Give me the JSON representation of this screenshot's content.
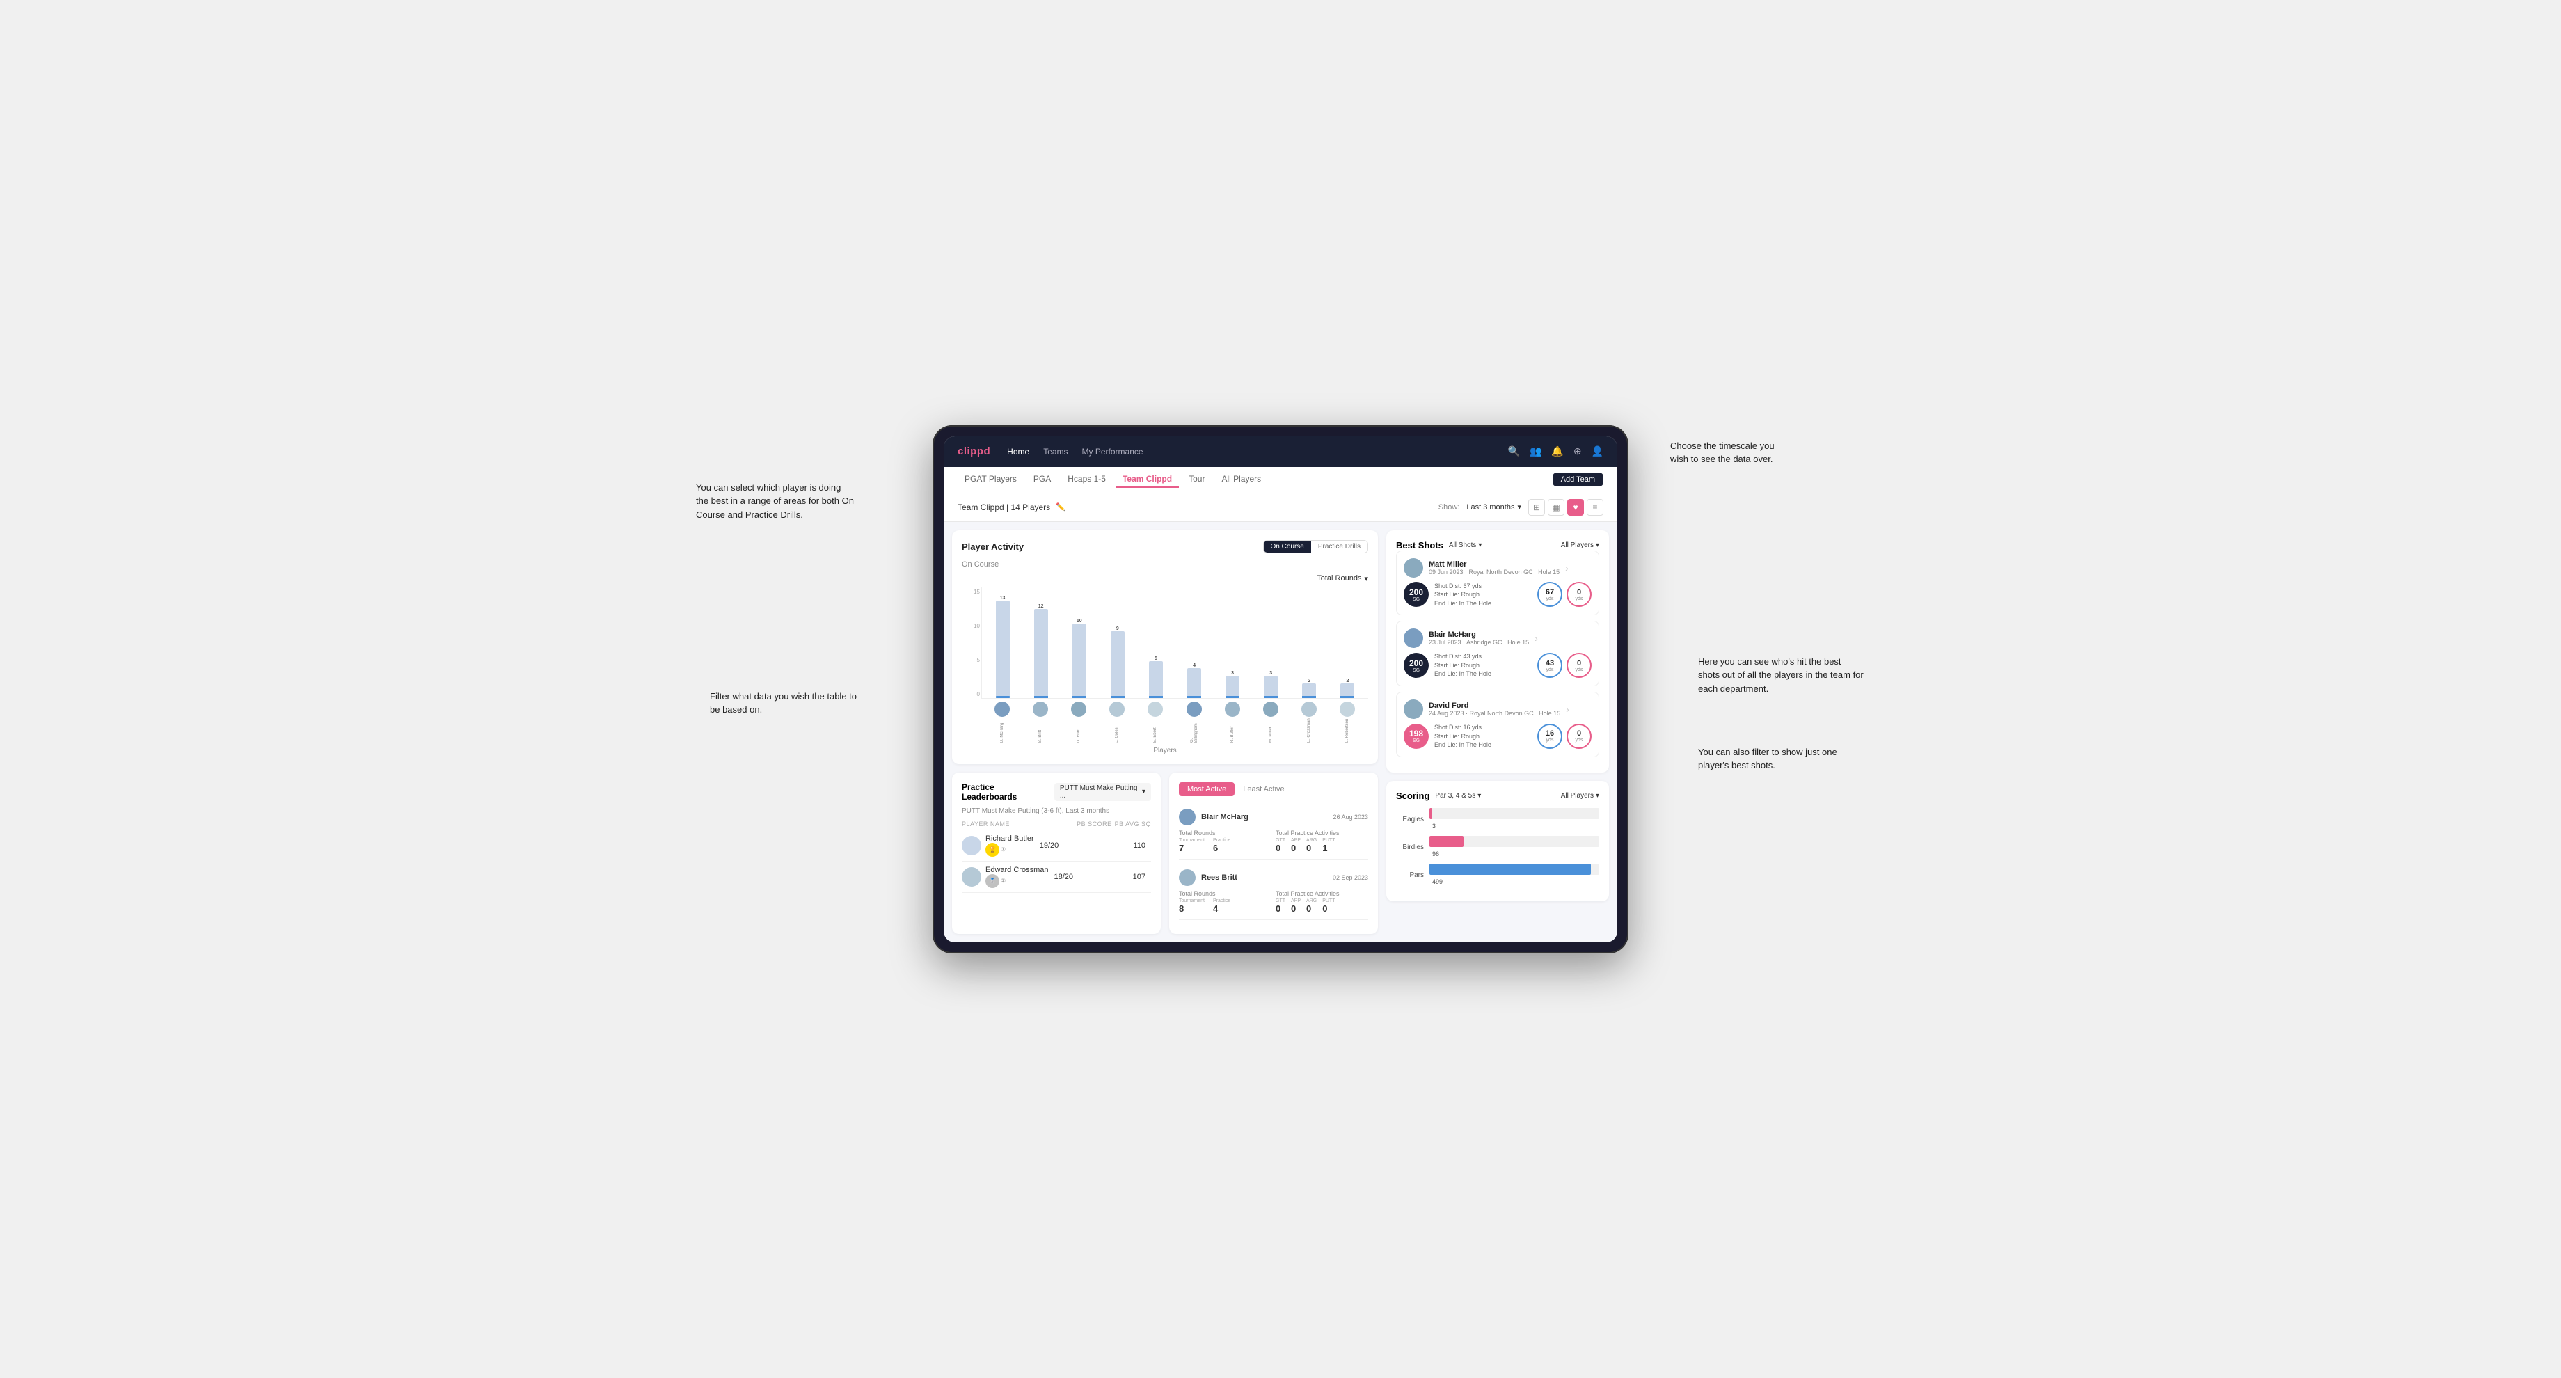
{
  "annotations": {
    "top_right": "Choose the timescale you\nwish to see the data over.",
    "left_top": "You can select which player is doing the best in a range of areas for both On Course and Practice Drills.",
    "left_bottom": "Filter what data you wish the table to be based on.",
    "right_mid": "Here you can see who's hit the best shots out of all the players in the team for each department.",
    "right_bottom": "You can also filter to show just one player's best shots."
  },
  "nav": {
    "logo": "clippd",
    "links": [
      "Home",
      "Teams",
      "My Performance"
    ],
    "icons": [
      "search",
      "users",
      "bell",
      "plus",
      "avatar"
    ]
  },
  "sub_nav": {
    "tabs": [
      "PGAT Players",
      "PGA",
      "Hcaps 1-5",
      "Team Clippd",
      "Tour",
      "All Players"
    ],
    "active_tab": "Team Clippd",
    "add_team_label": "Add Team"
  },
  "team_header": {
    "title": "Team Clippd | 14 Players",
    "show_label": "Show:",
    "date_filter": "Last 3 months",
    "view_modes": [
      "grid-2",
      "grid",
      "heart",
      "list"
    ]
  },
  "player_activity": {
    "title": "Player Activity",
    "toggle_left": "On Course",
    "toggle_right": "Practice Drills",
    "section_label": "On Course",
    "chart_filter": "Total Rounds",
    "players_label": "Players",
    "bars": [
      {
        "name": "B. McHarg",
        "value": 13
      },
      {
        "name": "B. Britt",
        "value": 12
      },
      {
        "name": "D. Ford",
        "value": 10
      },
      {
        "name": "J. Coles",
        "value": 9
      },
      {
        "name": "E. Ebert",
        "value": 5
      },
      {
        "name": "G. Billingham",
        "value": 4
      },
      {
        "name": "R. Butler",
        "value": 3
      },
      {
        "name": "M. Miller",
        "value": 3
      },
      {
        "name": "E. Crossman",
        "value": 2
      },
      {
        "name": "L. Robertson",
        "value": 2
      }
    ],
    "y_labels": [
      "15",
      "10",
      "5",
      "0"
    ]
  },
  "best_shots": {
    "title": "Best Shots",
    "filter1": "All Shots",
    "filter2": "All Players",
    "players": [
      {
        "name": "Matt Miller",
        "date": "09 Jun 2023",
        "course": "Royal North Devon GC",
        "hole": "Hole 15",
        "badge_num": "200",
        "badge_label": "SG",
        "shot_dist": "Shot Dist: 67 yds",
        "start_lie": "Start Lie: Rough",
        "end_lie": "End Lie: In The Hole",
        "metric1": "67",
        "metric1_unit": "yds",
        "metric2": "0",
        "metric2_unit": "yds"
      },
      {
        "name": "Blair McHarg",
        "date": "23 Jul 2023",
        "course": "Ashridge GC",
        "hole": "Hole 15",
        "badge_num": "200",
        "badge_label": "SG",
        "shot_dist": "Shot Dist: 43 yds",
        "start_lie": "Start Lie: Rough",
        "end_lie": "End Lie: In The Hole",
        "metric1": "43",
        "metric1_unit": "yds",
        "metric2": "0",
        "metric2_unit": "yds"
      },
      {
        "name": "David Ford",
        "date": "24 Aug 2023",
        "course": "Royal North Devon GC",
        "hole": "Hole 15",
        "badge_num": "198",
        "badge_label": "SG",
        "shot_dist": "Shot Dist: 16 yds",
        "start_lie": "Start Lie: Rough",
        "end_lie": "End Lie: In The Hole",
        "metric1": "16",
        "metric1_unit": "yds",
        "metric2": "0",
        "metric2_unit": "yds"
      }
    ]
  },
  "practice_leaderboards": {
    "title": "Practice Leaderboards",
    "filter": "PUTT Must Make Putting ...",
    "subtitle": "PUTT Must Make Putting (3-6 ft), Last 3 months",
    "cols": [
      "PLAYER NAME",
      "PB SCORE",
      "PB AVG SQ"
    ],
    "players": [
      {
        "rank": 1,
        "name": "Richard Butler",
        "pb_score": "19/20",
        "pb_avg": "110"
      },
      {
        "rank": 2,
        "name": "Edward Crossman",
        "pb_score": "18/20",
        "pb_avg": "107"
      }
    ]
  },
  "most_active": {
    "tabs": [
      "Most Active",
      "Least Active"
    ],
    "players": [
      {
        "name": "Blair McHarg",
        "date": "26 Aug 2023",
        "total_rounds_label": "Total Rounds",
        "tournament": "7",
        "practice": "6",
        "practice_activities_label": "Total Practice Activities",
        "gtt": "0",
        "app": "0",
        "arg": "0",
        "putt": "1"
      },
      {
        "name": "Rees Britt",
        "date": "02 Sep 2023",
        "total_rounds_label": "Total Rounds",
        "tournament": "8",
        "practice": "4",
        "practice_activities_label": "Total Practice Activities",
        "gtt": "0",
        "app": "0",
        "arg": "0",
        "putt": "0"
      }
    ]
  },
  "scoring": {
    "title": "Scoring",
    "filter1": "Par 3, 4 & 5s",
    "filter2": "All Players",
    "bars": [
      {
        "label": "Eagles",
        "value": 3,
        "color": "#e85d8a",
        "max": 500
      },
      {
        "label": "Birdies",
        "value": 96,
        "color": "#e85d8a",
        "max": 500
      },
      {
        "label": "Pars",
        "value": 499,
        "color": "#4a90d9",
        "max": 500
      }
    ]
  }
}
